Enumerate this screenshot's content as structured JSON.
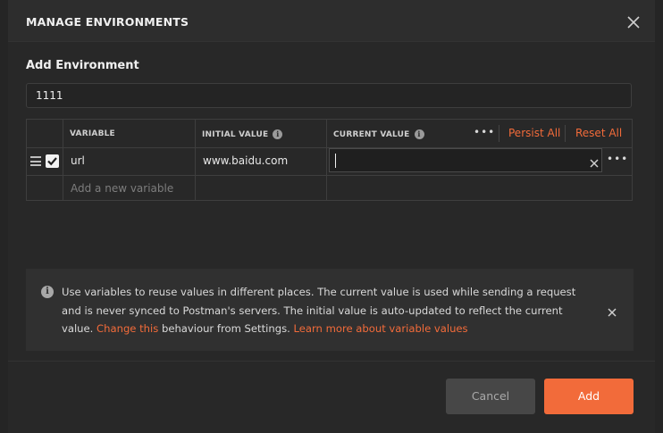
{
  "modal": {
    "title": "MANAGE ENVIRONMENTS",
    "section_title": "Add Environment",
    "environment_name": "1111"
  },
  "table": {
    "headers": {
      "variable": "VARIABLE",
      "initial_value": "INITIAL VALUE",
      "current_value": "CURRENT VALUE"
    },
    "persist_all_label": "Persist All",
    "reset_all_label": "Reset All",
    "more_label": "•••",
    "rows": [
      {
        "enabled": true,
        "variable": "url",
        "initial_value": "www.baidu.com",
        "current_value": ""
      }
    ],
    "new_variable_placeholder": "Add a new variable"
  },
  "info": {
    "text_main": "Use variables to reuse values in different places. The current value is used while sending a request and is never synced to Postman's servers. The initial value is auto-updated to reflect the current value. ",
    "link_change": "Change this",
    "text_after": " behaviour from Settings. ",
    "link_learn": "Learn more about variable values"
  },
  "buttons": {
    "cancel": "Cancel",
    "add": "Add"
  },
  "colors": {
    "accent": "#f26b3a",
    "modal_bg": "#282828",
    "header_bg": "#2d2d2d"
  },
  "icons": [
    "close-icon",
    "info-icon",
    "drag-handle-icon",
    "checkbox-checked-icon",
    "clear-icon",
    "more-options-icon"
  ]
}
